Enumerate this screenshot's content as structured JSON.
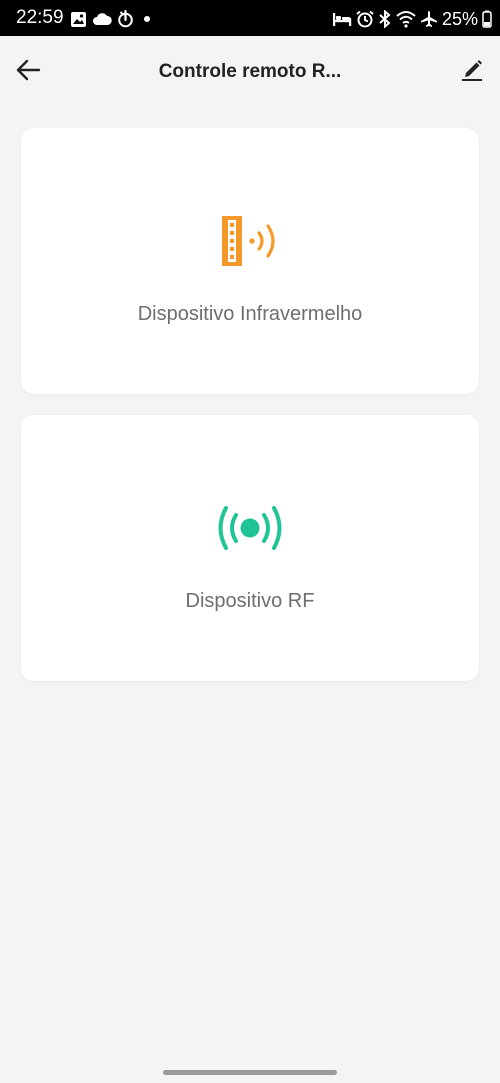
{
  "status_bar": {
    "time": "22:59",
    "battery": "25%",
    "left_icons": [
      "image-icon",
      "cloud-icon",
      "touch-icon",
      "dot-icon"
    ],
    "right_icons": [
      "bed-icon",
      "alarm-icon",
      "bluetooth-icon",
      "wifi-icon",
      "airplane-icon",
      "battery-icon"
    ]
  },
  "header": {
    "title": "Controle remoto R...",
    "back_icon": "arrow-left-icon",
    "edit_icon": "pencil-icon"
  },
  "devices": [
    {
      "label": "Dispositivo Infravermelho",
      "icon": "infrared-remote-icon",
      "color": "#f39a2a"
    },
    {
      "label": "Dispositivo RF",
      "icon": "rf-broadcast-icon",
      "color": "#1fc497"
    }
  ]
}
